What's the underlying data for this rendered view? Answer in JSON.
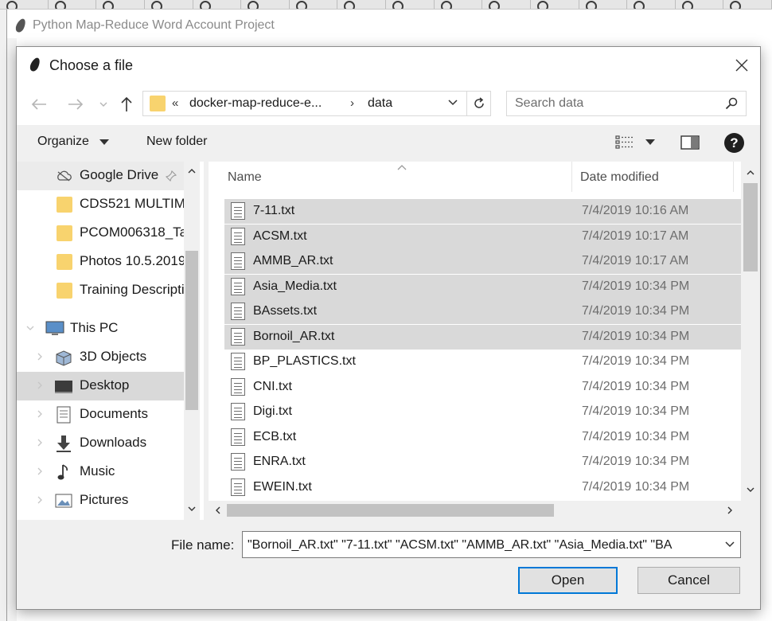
{
  "background_window": {
    "title": "Python Map-Reduce Word Account Project"
  },
  "dialog": {
    "title": "Choose a file",
    "address": {
      "segments": [
        "docker-map-reduce-e...",
        "data"
      ],
      "overflow": "«",
      "separator": "›"
    },
    "search": {
      "placeholder": "Search data"
    },
    "toolbar": {
      "organize": "Organize",
      "new_folder": "New folder",
      "help": "?"
    },
    "nav_pane": {
      "items": [
        {
          "label": "Google Drive",
          "icon": "cloud-icon"
        },
        {
          "label": "CDS521 MULTIM",
          "icon": "folder-icon"
        },
        {
          "label": "PCOM006318_Ta",
          "icon": "folder-icon"
        },
        {
          "label": "Photos 10.5.2019",
          "icon": "folder-icon"
        },
        {
          "label": "Training Descripti",
          "icon": "folder-icon"
        },
        {
          "label": "This PC",
          "icon": "computer-icon"
        },
        {
          "label": "3D Objects",
          "icon": "cube-icon"
        },
        {
          "label": "Desktop",
          "icon": "desktop-icon",
          "selected": true
        },
        {
          "label": "Documents",
          "icon": "documents-icon"
        },
        {
          "label": "Downloads",
          "icon": "download-icon"
        },
        {
          "label": "Music",
          "icon": "music-icon"
        },
        {
          "label": "Pictures",
          "icon": "pictures-icon"
        }
      ]
    },
    "file_list": {
      "columns": {
        "name": "Name",
        "date_modified": "Date modified"
      },
      "files": [
        {
          "name": "7-11.txt",
          "date": "7/4/2019 10:16 AM",
          "selected": true
        },
        {
          "name": "ACSM.txt",
          "date": "7/4/2019 10:17 AM",
          "selected": true
        },
        {
          "name": "AMMB_AR.txt",
          "date": "7/4/2019 10:17 AM",
          "selected": true
        },
        {
          "name": "Asia_Media.txt",
          "date": "7/4/2019 10:34 PM",
          "selected": true
        },
        {
          "name": "BAssets.txt",
          "date": "7/4/2019 10:34 PM",
          "selected": true
        },
        {
          "name": "Bornoil_AR.txt",
          "date": "7/4/2019 10:34 PM",
          "selected": true
        },
        {
          "name": "BP_PLASTICS.txt",
          "date": "7/4/2019 10:34 PM",
          "selected": false
        },
        {
          "name": "CNI.txt",
          "date": "7/4/2019 10:34 PM",
          "selected": false
        },
        {
          "name": "Digi.txt",
          "date": "7/4/2019 10:34 PM",
          "selected": false
        },
        {
          "name": "ECB.txt",
          "date": "7/4/2019 10:34 PM",
          "selected": false
        },
        {
          "name": "ENRA.txt",
          "date": "7/4/2019 10:34 PM",
          "selected": false
        },
        {
          "name": "EWEIN.txt",
          "date": "7/4/2019 10:34 PM",
          "selected": false
        }
      ]
    },
    "file_name": {
      "label": "File name:",
      "value": "\"Bornoil_AR.txt\" \"7-11.txt\" \"ACSM.txt\" \"AMMB_AR.txt\" \"Asia_Media.txt\" \"BA"
    },
    "buttons": {
      "open": "Open",
      "cancel": "Cancel"
    }
  },
  "colors": {
    "selection": "#d9d9d9",
    "accent": "#0078d7",
    "folder": "#f8d36e"
  }
}
